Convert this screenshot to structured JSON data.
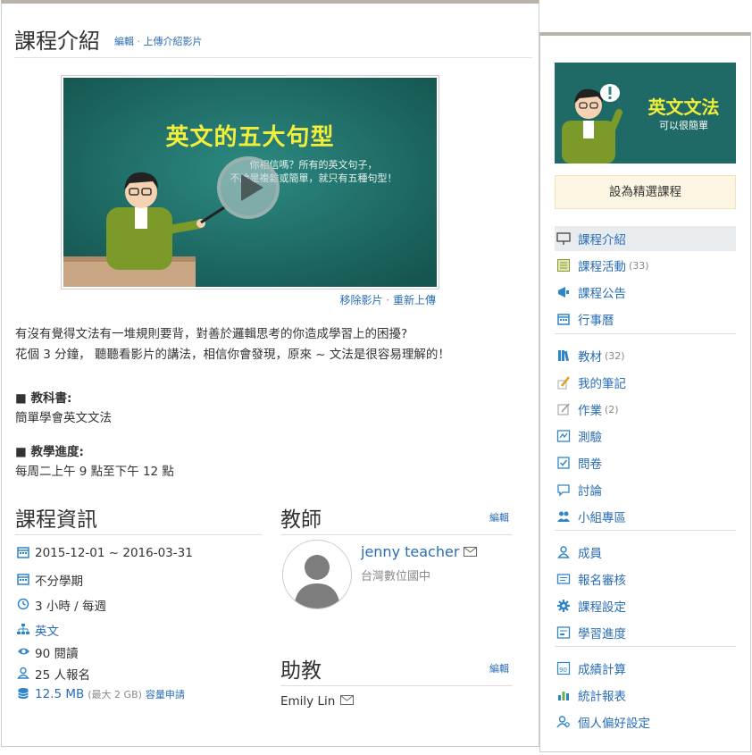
{
  "intro": {
    "title": "課程介紹",
    "edit_link": "編輯",
    "sep": " · ",
    "upload_link": "上傳介紹影片"
  },
  "video": {
    "headline": "英文的五大句型",
    "line1": "你相信嗎？所有的英文句子，",
    "line2": "不論是複雜或簡單，就只有五種句型！",
    "remove_link": "移除影片",
    "sep": " · ",
    "reupload_link": "重新上傳"
  },
  "description": {
    "line1": "有沒有覺得文法有一堆規則要背，對善於邏輯思考的你造成學習上的困擾?",
    "line2": "花個 3 分鐘， 聽聽看影片的講法，相信你會發現，原來 ~ 文法是很容易理解的！"
  },
  "textbook": {
    "label": "■ 教科書:",
    "value": "簡單學會英文文法"
  },
  "schedule": {
    "label": "■ 教學進度:",
    "value": "每周二上午 9 點至下午 12 點"
  },
  "course_info": {
    "title": "課程資訊",
    "dates": "2015-12-01 ~ 2016-03-31",
    "semester": "不分學期",
    "hours": "3 小時 / 每週",
    "category": "英文",
    "views": "90 閱讀",
    "enrolled": "25 人報名",
    "storage": "12.5 MB",
    "storage_max": "(最大 2 GB)",
    "storage_apply": "容量申請"
  },
  "teacher": {
    "title": "教師",
    "edit_link": "編輯",
    "name": "jenny teacher",
    "org": "台灣數位國中"
  },
  "assistant": {
    "title": "助教",
    "edit_link": "編輯",
    "name": "Emily Lin"
  },
  "sidebar": {
    "cover_title": "英文文法",
    "cover_subtitle": "可以很簡單",
    "feature_button": "設為精選課程",
    "menu": [
      {
        "label": "課程介紹",
        "count": ""
      },
      {
        "label": "課程活動",
        "count": "(33)"
      },
      {
        "label": "課程公告",
        "count": ""
      },
      {
        "label": "行事曆",
        "count": ""
      },
      {
        "label": "教材",
        "count": "(32)"
      },
      {
        "label": "我的筆記",
        "count": ""
      },
      {
        "label": "作業",
        "count": "(2)"
      },
      {
        "label": "測驗",
        "count": ""
      },
      {
        "label": "問卷",
        "count": ""
      },
      {
        "label": "討論",
        "count": ""
      },
      {
        "label": "小組專區",
        "count": ""
      },
      {
        "label": "成員",
        "count": ""
      },
      {
        "label": "報名審核",
        "count": ""
      },
      {
        "label": "課程設定",
        "count": ""
      },
      {
        "label": "學習進度",
        "count": ""
      },
      {
        "label": "成績計算",
        "count": ""
      },
      {
        "label": "統計報表",
        "count": ""
      },
      {
        "label": "個人偏好設定",
        "count": ""
      }
    ]
  },
  "colors": {
    "link": "#2a6db5",
    "board": "#1f6a66",
    "headline": "#f2ee3a"
  }
}
